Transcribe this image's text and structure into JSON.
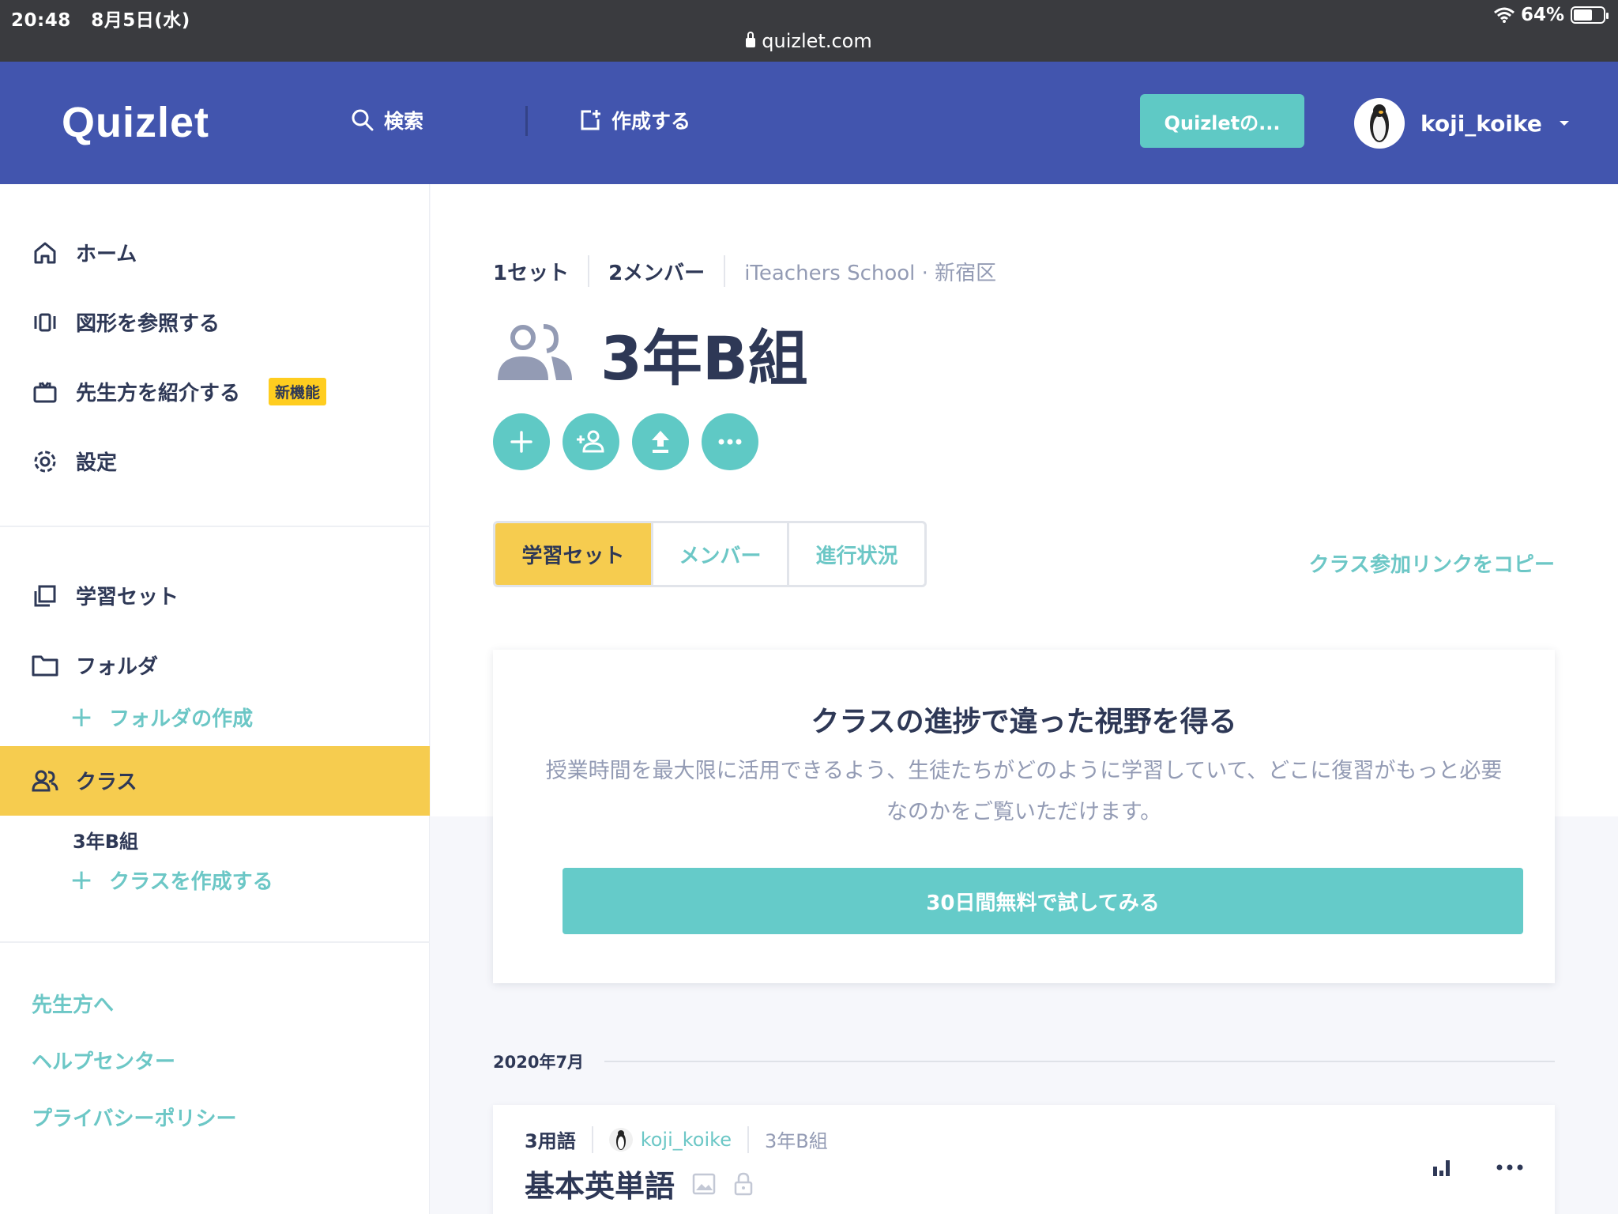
{
  "status_bar": {
    "time": "20:48",
    "date": "8月5日(水)",
    "battery_percent": "64%",
    "battery_level": 0.64
  },
  "browser": {
    "url": "quizlet.com"
  },
  "header": {
    "logo": "Quizlet",
    "search_label": "検索",
    "create_label": "作成する",
    "upgrade_button": "Quizletの...",
    "username": "koji_koike"
  },
  "sidebar": {
    "items": [
      {
        "label": "ホーム",
        "icon": "home-icon"
      },
      {
        "label": "図形を参照する",
        "icon": "cards-icon"
      },
      {
        "label": "先生方を紹介する",
        "icon": "gift-icon",
        "badge": "新機能"
      },
      {
        "label": "設定",
        "icon": "gear-icon"
      }
    ],
    "library": {
      "study_sets": "学習セット",
      "folders": "フォルダ",
      "create_folder": "フォルダの作成",
      "classes": "クラス",
      "class_item": "3年B組",
      "create_class": "クラスを作成する"
    },
    "footer": {
      "teachers": "先生方へ",
      "help": "ヘルプセンター",
      "privacy": "プライバシーポリシー"
    }
  },
  "class_page": {
    "sets_count": "1セット",
    "members_count": "2メンバー",
    "school": "iTeachers School · 新宿区",
    "title": "3年B組",
    "tabs": [
      "学習セット",
      "メンバー",
      "進行状況"
    ],
    "active_tab": "学習セット",
    "copy_link": "クラス参加リンクをコピー"
  },
  "promo": {
    "heading": "クラスの進捗で違った視野を得る",
    "body": "授業時間を最大限に活用できるよう、生徒たちがどのように学習していて、どこに復習がもっと必要なのかをご覧いただけます。",
    "button": "30日間無料で試してみる"
  },
  "sets_section": {
    "month": "2020年7月",
    "set": {
      "terms": "3用語",
      "author": "koji_koike",
      "class": "3年B組",
      "title": "基本英単語"
    }
  },
  "colors": {
    "header_bg": "#4255ae",
    "accent_teal": "#5fc9c5",
    "active_yellow": "#f6cc4f",
    "text_dark": "#2e3856",
    "text_muted": "#939bb4"
  }
}
